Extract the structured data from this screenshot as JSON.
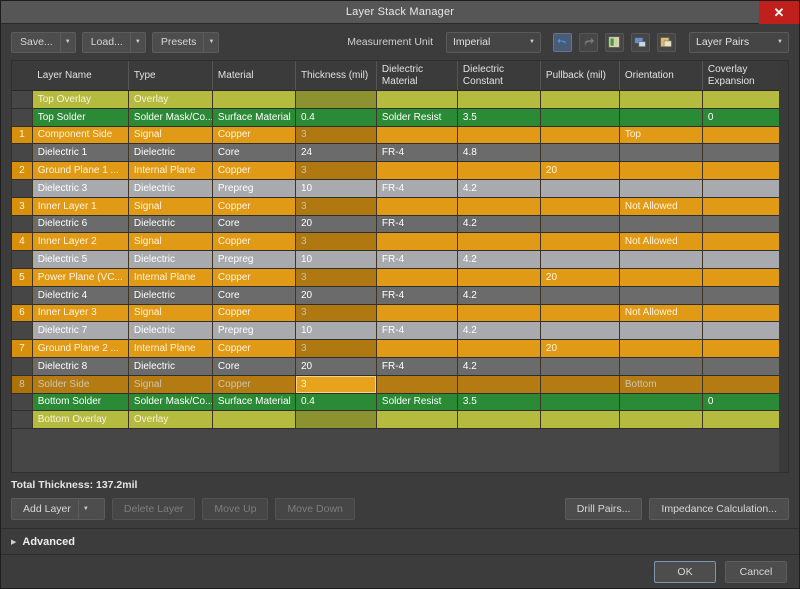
{
  "window": {
    "title": "Layer Stack Manager",
    "close_icon": "close-icon"
  },
  "toolbar": {
    "save_label": "Save...",
    "load_label": "Load...",
    "presets_label": "Presets",
    "measurement_unit_label": "Measurement Unit",
    "measurement_unit_value": "Imperial",
    "undo_icon": "undo-icon",
    "redo_icon": "redo-icon",
    "tool1_icon": "layer-properties-icon",
    "tool2_icon": "copy-layer-icon",
    "tool3_icon": "paste-layer-icon",
    "layer_pairs_value": "Layer Pairs",
    "caret_glyph": "▼"
  },
  "table": {
    "columns": [
      "",
      "Layer Name",
      "Type",
      "Material",
      "Thickness (mil)",
      "Dielectric Material",
      "Dielectric Constant",
      "Pullback (mil)",
      "Orientation",
      "Coverlay Expansion"
    ],
    "rows": [
      {
        "idx": "",
        "name": "Top Overlay",
        "type": "Overlay",
        "material": "",
        "thickness": "",
        "dmat": "",
        "dconst": "",
        "pullback": "",
        "orientation": "",
        "coverlay": "",
        "kind": "overlay",
        "dim_thickness": true
      },
      {
        "idx": "",
        "name": "Top Solder",
        "type": "Solder Mask/Co...",
        "material": "Surface Material",
        "thickness": "0.4",
        "dmat": "Solder Resist",
        "dconst": "3.5",
        "pullback": "",
        "orientation": "",
        "coverlay": "0",
        "kind": "solder"
      },
      {
        "idx": "1",
        "name": "Component Side",
        "type": "Signal",
        "material": "Copper",
        "thickness": "3",
        "dmat": "",
        "dconst": "",
        "pullback": "",
        "orientation": "Top",
        "coverlay": "",
        "kind": "signal",
        "dim_thickness": true
      },
      {
        "idx": "",
        "name": "Dielectric 1",
        "type": "Dielectric",
        "material": "Core",
        "thickness": "24",
        "dmat": "FR-4",
        "dconst": "4.8",
        "pullback": "",
        "orientation": "",
        "coverlay": "",
        "kind": "core"
      },
      {
        "idx": "2",
        "name": "Ground Plane 1 ...",
        "type": "Internal Plane",
        "material": "Copper",
        "thickness": "3",
        "dmat": "",
        "dconst": "",
        "pullback": "20",
        "orientation": "",
        "coverlay": "",
        "kind": "signal",
        "dim_thickness": true
      },
      {
        "idx": "",
        "name": "Dielectric 3",
        "type": "Dielectric",
        "material": "Prepreg",
        "thickness": "10",
        "dmat": "FR-4",
        "dconst": "4.2",
        "pullback": "",
        "orientation": "",
        "coverlay": "",
        "kind": "prepreg"
      },
      {
        "idx": "3",
        "name": "Inner Layer 1",
        "type": "Signal",
        "material": "Copper",
        "thickness": "3",
        "dmat": "",
        "dconst": "",
        "pullback": "",
        "orientation": "Not Allowed",
        "coverlay": "",
        "kind": "signal",
        "dim_thickness": true
      },
      {
        "idx": "",
        "name": "Dielectric 6",
        "type": "Dielectric",
        "material": "Core",
        "thickness": "20",
        "dmat": "FR-4",
        "dconst": "4.2",
        "pullback": "",
        "orientation": "",
        "coverlay": "",
        "kind": "core"
      },
      {
        "idx": "4",
        "name": "Inner Layer 2",
        "type": "Signal",
        "material": "Copper",
        "thickness": "3",
        "dmat": "",
        "dconst": "",
        "pullback": "",
        "orientation": "Not Allowed",
        "coverlay": "",
        "kind": "signal",
        "dim_thickness": true
      },
      {
        "idx": "",
        "name": "Dielectric 5",
        "type": "Dielectric",
        "material": "Prepreg",
        "thickness": "10",
        "dmat": "FR-4",
        "dconst": "4.2",
        "pullback": "",
        "orientation": "",
        "coverlay": "",
        "kind": "prepreg"
      },
      {
        "idx": "5",
        "name": "Power Plane (VC...",
        "type": "Internal Plane",
        "material": "Copper",
        "thickness": "3",
        "dmat": "",
        "dconst": "",
        "pullback": "20",
        "orientation": "",
        "coverlay": "",
        "kind": "signal",
        "dim_thickness": true
      },
      {
        "idx": "",
        "name": "Dielectric 4",
        "type": "Dielectric",
        "material": "Core",
        "thickness": "20",
        "dmat": "FR-4",
        "dconst": "4.2",
        "pullback": "",
        "orientation": "",
        "coverlay": "",
        "kind": "core"
      },
      {
        "idx": "6",
        "name": "Inner Layer 3",
        "type": "Signal",
        "material": "Copper",
        "thickness": "3",
        "dmat": "",
        "dconst": "",
        "pullback": "",
        "orientation": "Not Allowed",
        "coverlay": "",
        "kind": "signal",
        "dim_thickness": true
      },
      {
        "idx": "",
        "name": "Dielectric 7",
        "type": "Dielectric",
        "material": "Prepreg",
        "thickness": "10",
        "dmat": "FR-4",
        "dconst": "4.2",
        "pullback": "",
        "orientation": "",
        "coverlay": "",
        "kind": "prepreg"
      },
      {
        "idx": "7",
        "name": "Ground Plane 2 ...",
        "type": "Internal Plane",
        "material": "Copper",
        "thickness": "3",
        "dmat": "",
        "dconst": "",
        "pullback": "20",
        "orientation": "",
        "coverlay": "",
        "kind": "signal",
        "dim_thickness": true
      },
      {
        "idx": "",
        "name": "Dielectric 8",
        "type": "Dielectric",
        "material": "Core",
        "thickness": "20",
        "dmat": "FR-4",
        "dconst": "4.2",
        "pullback": "",
        "orientation": "",
        "coverlay": "",
        "kind": "core"
      },
      {
        "idx": "8",
        "name": "Solder Side",
        "type": "Signal",
        "material": "Copper",
        "thickness": "3",
        "dmat": "",
        "dconst": "",
        "pullback": "",
        "orientation": "Bottom",
        "coverlay": "",
        "kind": "signal",
        "selected": true,
        "editing_thickness": true
      },
      {
        "idx": "",
        "name": "Bottom Solder",
        "type": "Solder Mask/Co...",
        "material": "Surface Material",
        "thickness": "0.4",
        "dmat": "Solder Resist",
        "dconst": "3.5",
        "pullback": "",
        "orientation": "",
        "coverlay": "0",
        "kind": "solder"
      },
      {
        "idx": "",
        "name": "Bottom Overlay",
        "type": "Overlay",
        "material": "",
        "thickness": "",
        "dmat": "",
        "dconst": "",
        "pullback": "",
        "orientation": "",
        "coverlay": "",
        "kind": "overlay",
        "dim_thickness": true
      }
    ]
  },
  "footer": {
    "total_thickness": "Total Thickness: 137.2mil",
    "add_layer_label": "Add Layer",
    "delete_layer_label": "Delete Layer",
    "move_up_label": "Move Up",
    "move_down_label": "Move Down",
    "drill_pairs_label": "Drill Pairs...",
    "impedance_label": "Impedance Calculation..."
  },
  "advanced": {
    "label": "Advanced",
    "triangle_glyph": "▶"
  },
  "dialog": {
    "ok_label": "OK",
    "cancel_label": "Cancel"
  },
  "colors": {
    "accent_close": "#c0201c",
    "signal": "#e09a15",
    "solder": "#2b8a35",
    "overlay": "#b5bb3e",
    "core": "#6b6b6b",
    "prepreg": "#a8aaad"
  }
}
